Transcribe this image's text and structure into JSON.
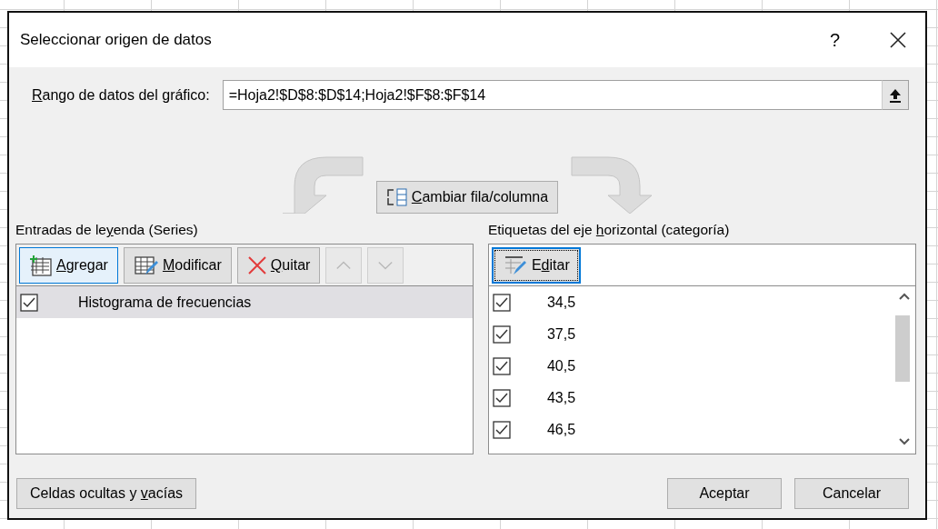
{
  "window": {
    "title": "Seleccionar origen de datos",
    "help": "?"
  },
  "range": {
    "label": [
      {
        "text": "R",
        "underline": true
      },
      {
        "text": "ango de datos del gráfico:",
        "underline": false
      }
    ],
    "value": "=Hoja2!$D$8:$D$14;Hoja2!$F$8:$F$14"
  },
  "switch_button": {
    "label": [
      {
        "text": "C",
        "underline": true
      },
      {
        "text": "ambiar fila/columna",
        "underline": false
      }
    ]
  },
  "legend": {
    "title": [
      {
        "text": "Entradas de le",
        "underline": false
      },
      {
        "text": "y",
        "underline": true
      },
      {
        "text": "enda (Series)",
        "underline": false
      }
    ],
    "buttons": [
      {
        "kind": "add",
        "label": [
          {
            "text": "A",
            "underline": true
          },
          {
            "text": "gregar",
            "underline": false
          }
        ],
        "focused": true,
        "disabled": false
      },
      {
        "kind": "edit",
        "label": [
          {
            "text": "M",
            "underline": true
          },
          {
            "text": "odificar",
            "underline": false
          }
        ],
        "focused": false,
        "disabled": false
      },
      {
        "kind": "remove",
        "label": [
          {
            "text": "Q",
            "underline": true
          },
          {
            "text": "uitar",
            "underline": false
          }
        ],
        "focused": false,
        "disabled": false
      },
      {
        "kind": "up",
        "focused": false,
        "disabled": true
      },
      {
        "kind": "down",
        "focused": false,
        "disabled": true
      }
    ],
    "series": [
      {
        "name": "Histograma de frecuencias",
        "checked": true,
        "selected": true
      }
    ]
  },
  "axis": {
    "title": [
      {
        "text": "Etiquetas del eje ",
        "underline": false
      },
      {
        "text": "h",
        "underline": true
      },
      {
        "text": "orizontal (categoría)",
        "underline": false
      }
    ],
    "edit_button": {
      "label": [
        {
          "text": "E",
          "underline": false
        },
        {
          "text": "d",
          "underline": true
        },
        {
          "text": "itar",
          "underline": false
        }
      ],
      "focused": true
    },
    "categories": [
      {
        "label": "34,5",
        "checked": true
      },
      {
        "label": "37,5",
        "checked": true
      },
      {
        "label": "40,5",
        "checked": true
      },
      {
        "label": "43,5",
        "checked": true
      },
      {
        "label": "46,5",
        "checked": true
      }
    ]
  },
  "footer": {
    "hidden_button": {
      "label": [
        {
          "text": "Celdas ocultas y ",
          "underline": false
        },
        {
          "text": "v",
          "underline": true
        },
        {
          "text": "acías",
          "underline": false
        }
      ]
    },
    "ok": "Aceptar",
    "cancel": "Cancelar"
  }
}
